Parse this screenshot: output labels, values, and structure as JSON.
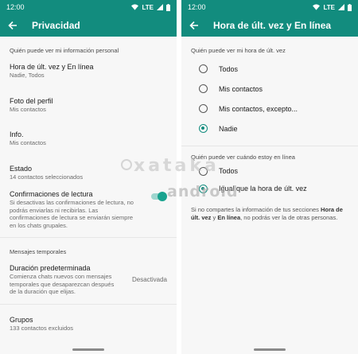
{
  "left": {
    "status": {
      "time": "12:00",
      "network": "LTE"
    },
    "appbar": {
      "title": "Privacidad"
    },
    "section1": "Quién puede ver mi información personal",
    "items": [
      {
        "title": "Hora de últ. vez y En línea",
        "subtitle": "Nadie, Todos"
      },
      {
        "title": "Foto del perfil",
        "subtitle": "Mis contactos"
      },
      {
        "title": "Info.",
        "subtitle": "Mis contactos"
      },
      {
        "title": "Estado",
        "subtitle": "14 contactos seleccionados"
      }
    ],
    "read_receipts": {
      "title": "Confirmaciones de lectura",
      "description": "Si desactivas las confirmaciones de lectura, no podrás enviarlas ni recibirlas. Las confirmaciones de lectura se enviarán siempre en los chats grupales.",
      "enabled": true
    },
    "section2": "Mensajes temporales",
    "default_duration": {
      "title": "Duración predeterminada",
      "description": "Comienza chats nuevos con mensajes temporales que desaparezcan después de la duración que elijas.",
      "value": "Desactivada"
    },
    "groups": {
      "title": "Grupos",
      "subtitle": "133 contactos excluidos"
    }
  },
  "right": {
    "status": {
      "time": "12:00",
      "network": "LTE"
    },
    "appbar": {
      "title": "Hora de últ. vez y En línea"
    },
    "section1": "Quién puede ver mi hora de últ. vez",
    "options1": [
      {
        "label": "Todos",
        "selected": false
      },
      {
        "label": "Mis contactos",
        "selected": false
      },
      {
        "label": "Mis contactos, excepto...",
        "selected": false
      },
      {
        "label": "Nadie",
        "selected": true
      }
    ],
    "section2": "Quién puede ver cuándo estoy en línea",
    "options2": [
      {
        "label": "Todos",
        "selected": false
      },
      {
        "label": "Igual que la hora de últ. vez",
        "selected": true
      }
    ],
    "note_pre": "Si no compartes la información de tus secciones ",
    "note_bold1": "Hora de últ. vez",
    "note_mid": " y ",
    "note_bold2": "En línea",
    "note_post": ", no podrás ver la de otras personas."
  },
  "watermark": {
    "top": "xataka",
    "bottom": "android"
  },
  "colors": {
    "primary": "#128c7e",
    "accent": "#1aa38f"
  }
}
